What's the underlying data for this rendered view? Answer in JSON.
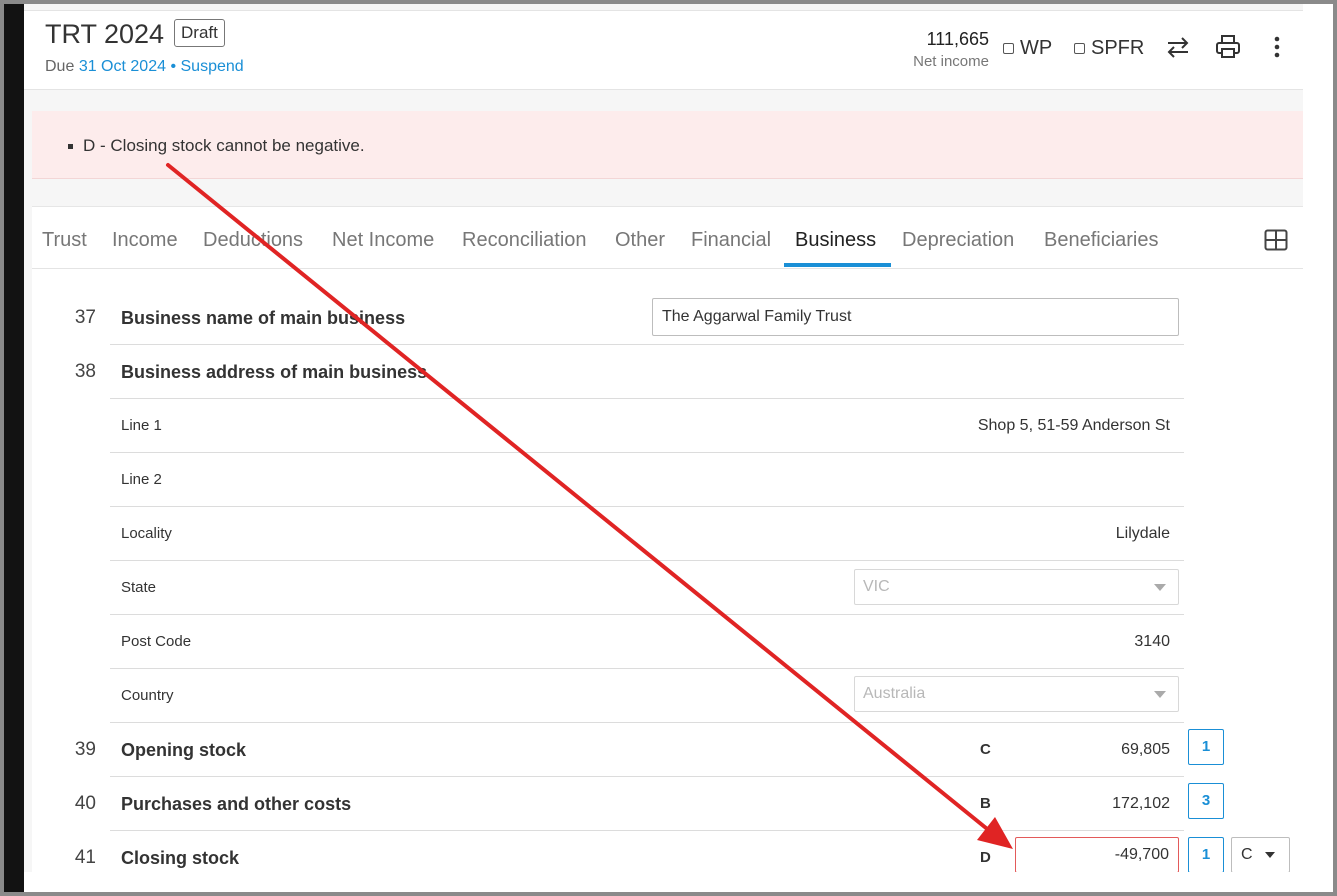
{
  "header": {
    "title": "TRT 2024",
    "status_badge": "Draft",
    "due_prefix": "Due",
    "due_date": "31 Oct 2024",
    "separator": "•",
    "suspend_link": "Suspend",
    "net_income_value": "111,665",
    "net_income_label": "Net income",
    "wp_label": "WP",
    "spfr_label": "SPFR",
    "icons": [
      "swap-arrows-icon",
      "printer-icon",
      "more-vertical-icon"
    ]
  },
  "alert": {
    "items": [
      "D - Closing stock cannot be negative."
    ],
    "background": "#fdecec"
  },
  "tabs": {
    "items": [
      "Trust",
      "Income",
      "Deductions",
      "Net Income",
      "Reconciliation",
      "Other",
      "Financial",
      "Business",
      "Depreciation",
      "Beneficiaries"
    ],
    "active": "Business",
    "accent": "#1a8fd6"
  },
  "form": {
    "q37": {
      "num": "37",
      "label": "Business name of main business",
      "value": "The Aggarwal Family Trust"
    },
    "q38": {
      "num": "38",
      "label": "Business address of main business",
      "line1_label": "Line 1",
      "line1_value": "Shop 5, 51-59 Anderson St",
      "line2_label": "Line 2",
      "line2_value": "",
      "locality_label": "Locality",
      "locality_value": "Lilydale",
      "state_label": "State",
      "state_value": "VIC",
      "postcode_label": "Post Code",
      "postcode_value": "3140",
      "country_label": "Country",
      "country_value": "Australia"
    },
    "q39": {
      "num": "39",
      "label": "Opening stock",
      "code": "C",
      "amount": "69,805",
      "count": "1"
    },
    "q40": {
      "num": "40",
      "label": "Purchases and other costs",
      "code": "B",
      "amount": "172,102",
      "count": "3"
    },
    "q41": {
      "num": "41",
      "label": "Closing stock",
      "code": "D",
      "amount": "-49,700",
      "count": "1",
      "dropdown": "C"
    }
  },
  "colors": {
    "error_border": "#e35a5a",
    "annotation_arrow": "#e02424"
  }
}
